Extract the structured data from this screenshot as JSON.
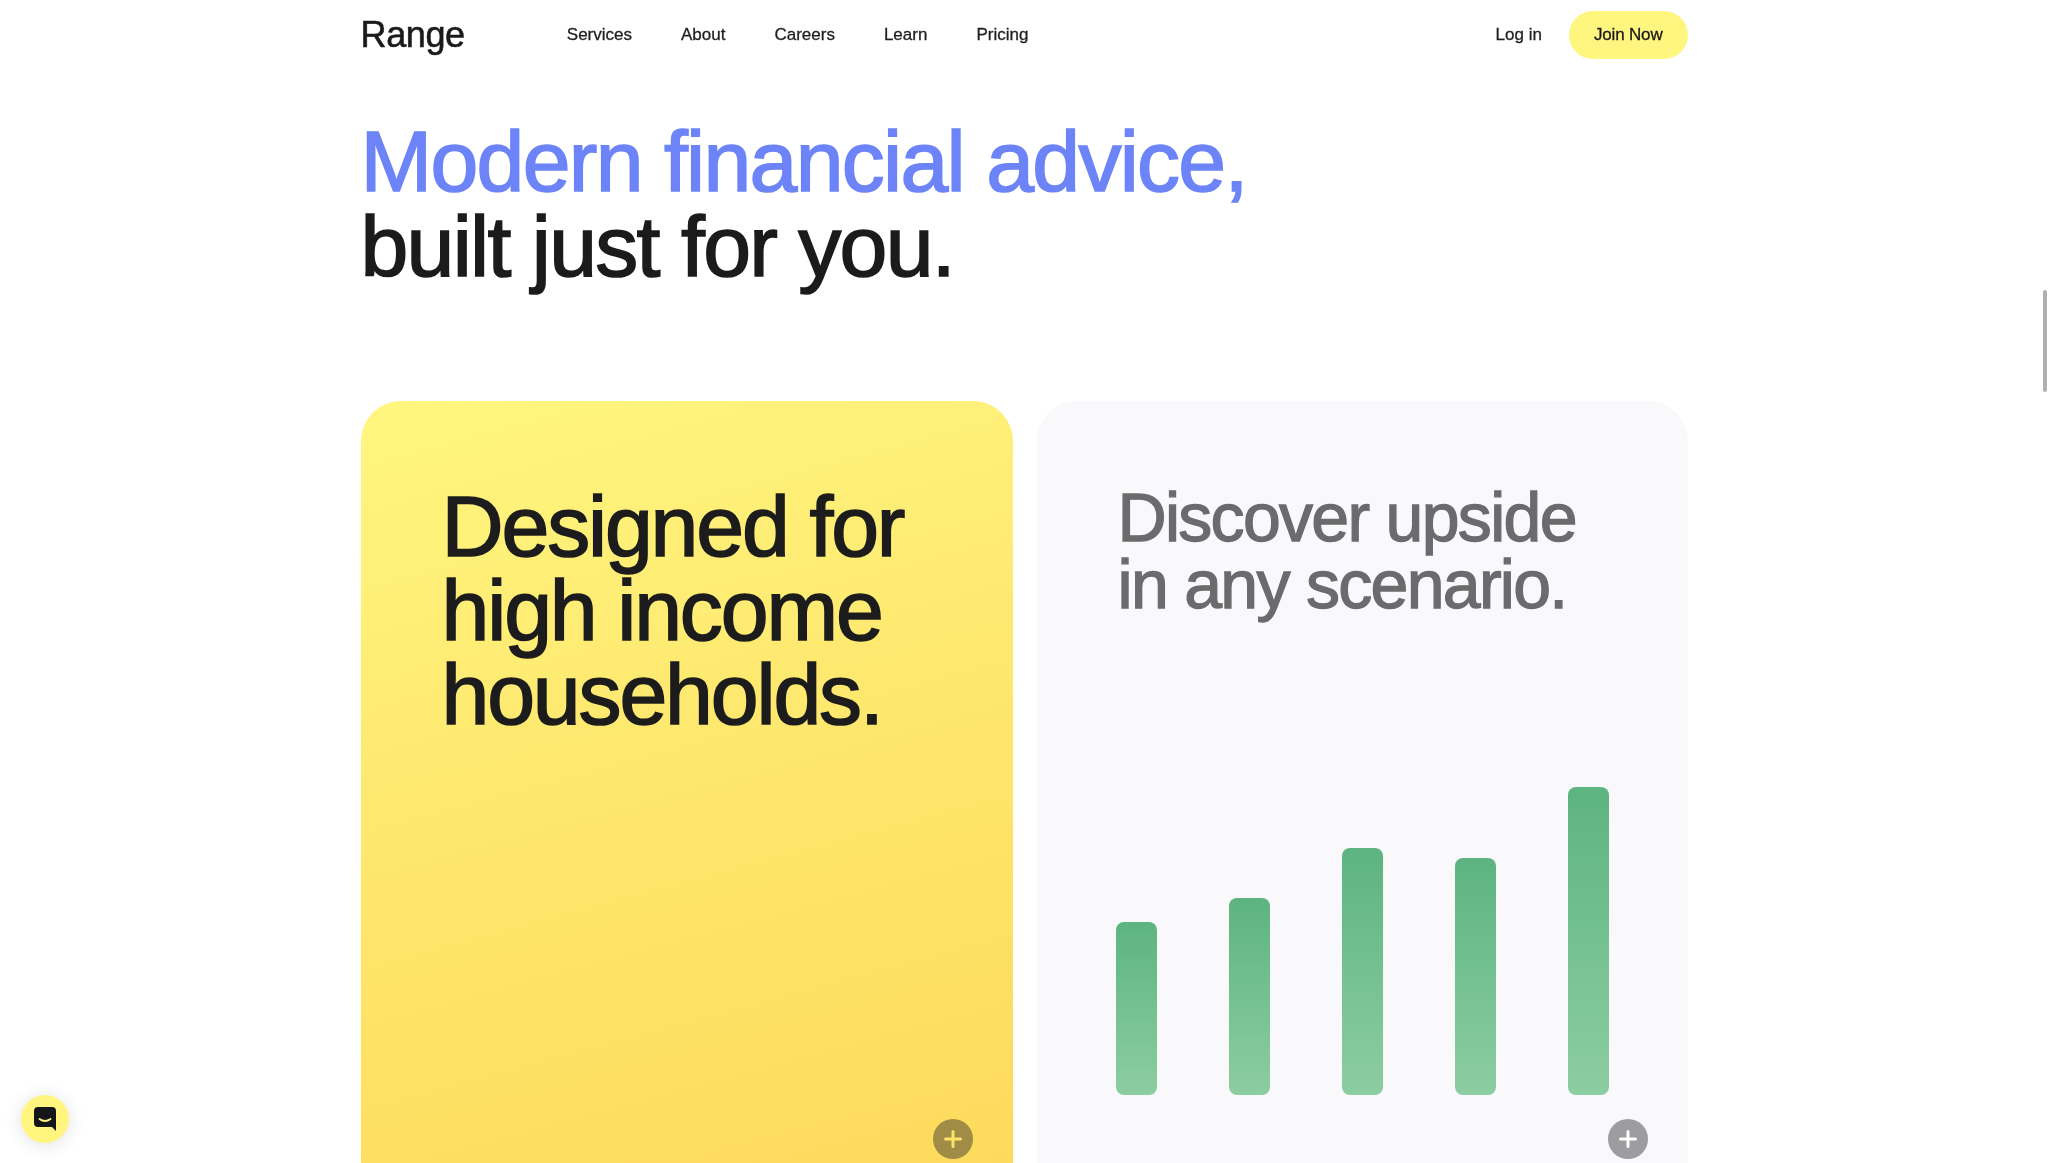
{
  "nav": {
    "logo": "Range",
    "links": [
      "Services",
      "About",
      "Careers",
      "Learn",
      "Pricing"
    ],
    "login": "Log in",
    "cta": "Join Now"
  },
  "hero": {
    "headline_accent": "Modern financial advice,",
    "headline_rest": "built just for you."
  },
  "cards": [
    {
      "kind": "plain",
      "title": "Designed for\nhigh income\nhouseholds."
    },
    {
      "kind": "chart",
      "title": "Discover upside\nin any scenario."
    }
  ]
}
